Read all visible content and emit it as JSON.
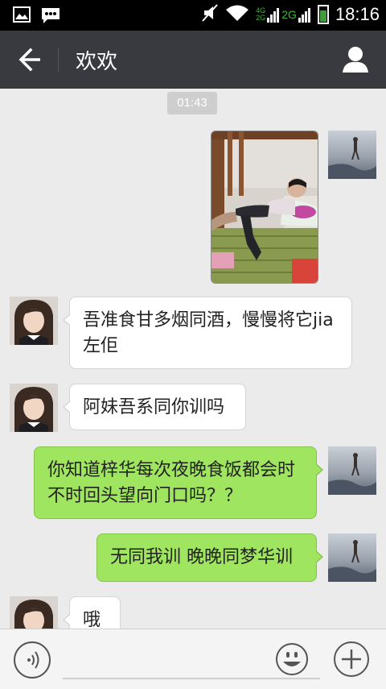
{
  "status_bar": {
    "time": "18:16",
    "network_primary": "4G",
    "network_secondary_label": "2G",
    "network_secondary": "2G",
    "icons": [
      "image-icon",
      "message-icon",
      "mute-icon",
      "wifi-icon",
      "signal-icon",
      "battery-icon"
    ]
  },
  "header": {
    "title": "欢欢",
    "back_icon": "back-arrow-icon",
    "profile_icon": "person-icon"
  },
  "chat": {
    "timestamp": "01:43",
    "messages": [
      {
        "side": "right",
        "type": "image"
      },
      {
        "side": "left",
        "type": "text",
        "text": "吾准食甘多烟同酒，慢慢将它jia左佢"
      },
      {
        "side": "left",
        "type": "text",
        "text": "阿妹吾系同你训吗"
      },
      {
        "side": "right",
        "type": "text",
        "text": "你知道梓华每次夜晚食饭都会时不时回头望向门口吗？？"
      },
      {
        "side": "right",
        "type": "text",
        "text": "无同我训 晚晚同梦华训"
      },
      {
        "side": "left",
        "type": "text",
        "text": "哦"
      }
    ]
  },
  "input_bar": {
    "voice_icon": "voice-icon",
    "emoji_icon": "emoji-icon",
    "plus_icon": "plus-icon"
  },
  "colors": {
    "header_bg": "#393a3f",
    "chat_bg": "#ebebeb",
    "outgoing_bubble": "#9fe55f",
    "incoming_bubble": "#ffffff"
  }
}
